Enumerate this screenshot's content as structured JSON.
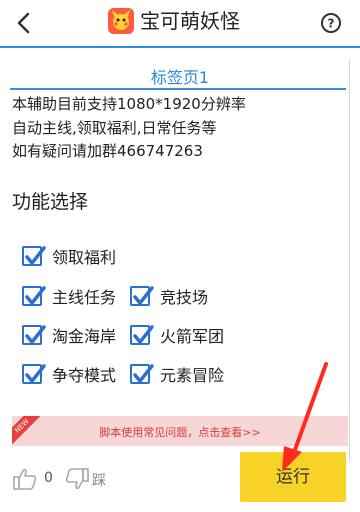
{
  "header": {
    "title": "宝可萌妖怪",
    "back_icon": "back-arrow-icon",
    "help_icon": "help-icon"
  },
  "tab": {
    "label": "标签页1"
  },
  "info": {
    "line1": "本辅助目前支持1080*1920分辨率",
    "line2": "自动主线,领取福利,日常任务等",
    "line3": "如有疑问请加群466747263"
  },
  "section": {
    "title": "功能选择"
  },
  "options": [
    {
      "label": "领取福利",
      "checked": true
    },
    {
      "label": "主线任务",
      "checked": true
    },
    {
      "label": "竞技场",
      "checked": true
    },
    {
      "label": "淘金海岸",
      "checked": true
    },
    {
      "label": "火箭军团",
      "checked": true
    },
    {
      "label": "争夺模式",
      "checked": true
    },
    {
      "label": "元素冒险",
      "checked": true
    }
  ],
  "banner": {
    "tag": "NEW",
    "text": "脚本使用常见问题，点击查看>>"
  },
  "footer": {
    "like_count": "0",
    "dislike_label": "踩",
    "run_label": "运行"
  },
  "colors": {
    "accent": "#2b8ae6",
    "run_button": "#f7d227",
    "banner_bg": "#f6d6d6",
    "banner_text": "#e03a3a"
  }
}
